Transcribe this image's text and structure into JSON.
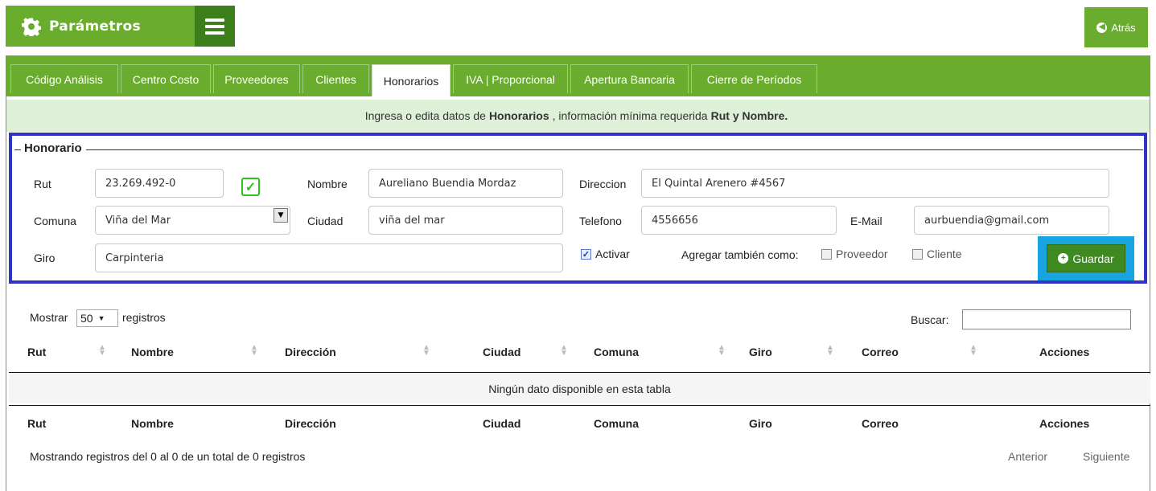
{
  "header": {
    "title": "Parámetros",
    "back_label": "Atrás",
    "icons": {
      "settings": "gear-icon",
      "menu": "hamburger-icon",
      "back": "arrow-left-circle-icon"
    }
  },
  "tabs": [
    {
      "label": "Código Análisis",
      "active": false
    },
    {
      "label": "Centro Costo",
      "active": false
    },
    {
      "label": "Proveedores",
      "active": false
    },
    {
      "label": "Clientes",
      "active": false
    },
    {
      "label": "Honorarios",
      "active": true
    },
    {
      "label": "IVA | Proporcional",
      "active": false
    },
    {
      "label": "Apertura Bancaria",
      "active": false
    },
    {
      "label": "Cierre de Períodos",
      "active": false
    }
  ],
  "info": {
    "prefix": "Ingresa o edita datos de",
    "entity": "Honorarios",
    "middle": ", información mínima requerida",
    "required": "Rut y Nombre."
  },
  "form": {
    "legend": "Honorario",
    "rut_label": "Rut",
    "rut_value": "23.269.492-0",
    "nombre_label": "Nombre",
    "nombre_value": "Aureliano Buendia Mordaz",
    "direccion_label": "Direccion",
    "direccion_value": "El Quintal Arenero #4567",
    "comuna_label": "Comuna",
    "comuna_value": "Viña del Mar",
    "ciudad_label": "Ciudad",
    "ciudad_value": "viña del mar",
    "telefono_label": "Telefono",
    "telefono_value": "4556656",
    "email_label": "E-Mail",
    "email_value": "aurbuendia@gmail.com",
    "giro_label": "Giro",
    "giro_value": "Carpinteria",
    "activar_label": "Activar",
    "activar_checked": true,
    "agregar_label": "Agregar también como:",
    "proveedor_label": "Proveedor",
    "proveedor_checked": false,
    "cliente_label": "Cliente",
    "cliente_checked": false,
    "save_label": "Guardar",
    "colors": {
      "form_border": "#2d35c4",
      "save_highlight": "#17a4e0",
      "valid": "#2ec21f"
    }
  },
  "table": {
    "show_prefix": "Mostrar",
    "page_size": "50",
    "show_suffix": "registros",
    "search_label": "Buscar:",
    "search_value": "",
    "columns": [
      "Rut",
      "Nombre",
      "Dirección",
      "Ciudad",
      "Comuna",
      "Giro",
      "Correo",
      "Acciones"
    ],
    "empty_message": "Ningún dato disponible en esta tabla",
    "summary": "Mostrando registros del 0 al 0 de un total de 0 registros",
    "prev_label": "Anterior",
    "next_label": "Siguiente"
  },
  "theme": {
    "brand_green": "#6aac2e",
    "dark_green": "#3c7f1a",
    "info_bg": "#dff0d8"
  }
}
